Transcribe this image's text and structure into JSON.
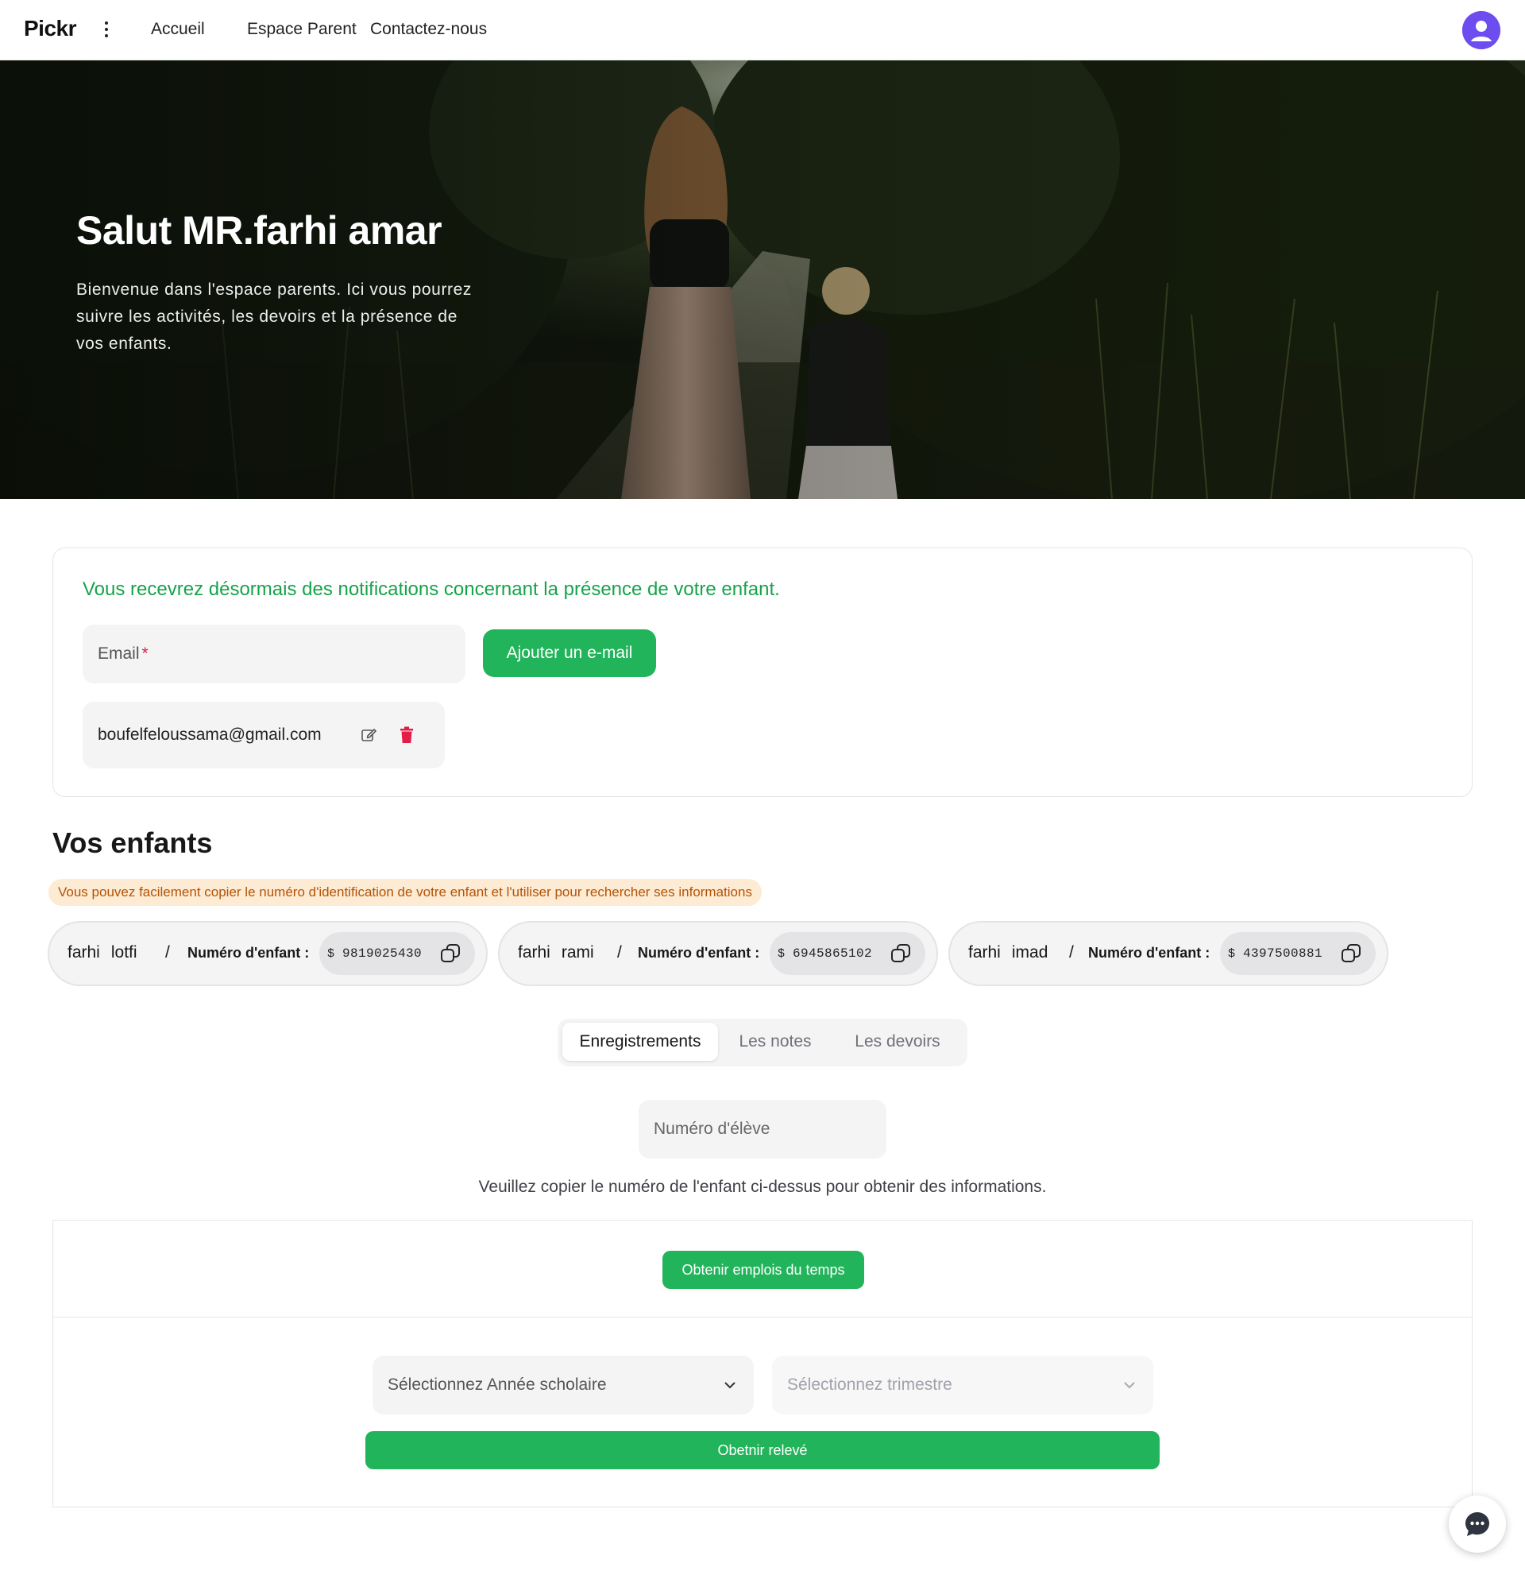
{
  "nav": {
    "brand": "Pickr",
    "links": [
      "Accueil",
      "Espace Parent",
      "Contactez-nous"
    ]
  },
  "hero": {
    "title": "Salut MR.farhi amar",
    "text": "Bienvenue dans l'espace parents. Ici vous pourrez suivre les activités, les devoirs et la présence de vos enfants."
  },
  "notifications": {
    "title": "Vous recevrez désormais des notifications concernant la présence de votre enfant.",
    "email_placeholder": "Email",
    "required_mark": "*",
    "add_button": "Ajouter un e-mail",
    "saved_email": "boufelfeloussama@gmail.com"
  },
  "children": {
    "title": "Vos enfants",
    "hint": "Vous pouvez facilement copier le numéro d'identification de votre enfant et l'utiliser pour rechercher ses informations",
    "label": "Numéro d'enfant :",
    "currency_prefix": "$",
    "list": [
      {
        "last": "farhi",
        "first": "lotfi",
        "id": "9819025430"
      },
      {
        "last": "farhi",
        "first": "rami",
        "id": "6945865102"
      },
      {
        "last": "farhi",
        "first": "imad",
        "id": "4397500881"
      }
    ]
  },
  "tabs": {
    "items": [
      "Enregistrements",
      "Les notes",
      "Les devoirs"
    ],
    "active": "Enregistrements"
  },
  "records": {
    "student_placeholder": "Numéro d'élève",
    "copy_hint": "Veuillez copier le numéro de l'enfant ci-dessus pour obtenir des informations.",
    "timetable_button": "Obtenir emplois du temps",
    "year_select": "Sélectionnez Année scholaire",
    "term_select": "Sélectionnez trimestre",
    "releve_button": "Obetnir relevé"
  },
  "colors": {
    "accent_green": "#22b45a",
    "notif_green": "#16a34a",
    "danger": "#e11d48",
    "hint_bg": "#fdebd3",
    "hint_text": "#b45309"
  },
  "icons": [
    "menu-dots-icon",
    "user-avatar-icon",
    "edit-icon",
    "trash-icon",
    "copy-icon",
    "chevron-down-icon",
    "chat-icon"
  ]
}
